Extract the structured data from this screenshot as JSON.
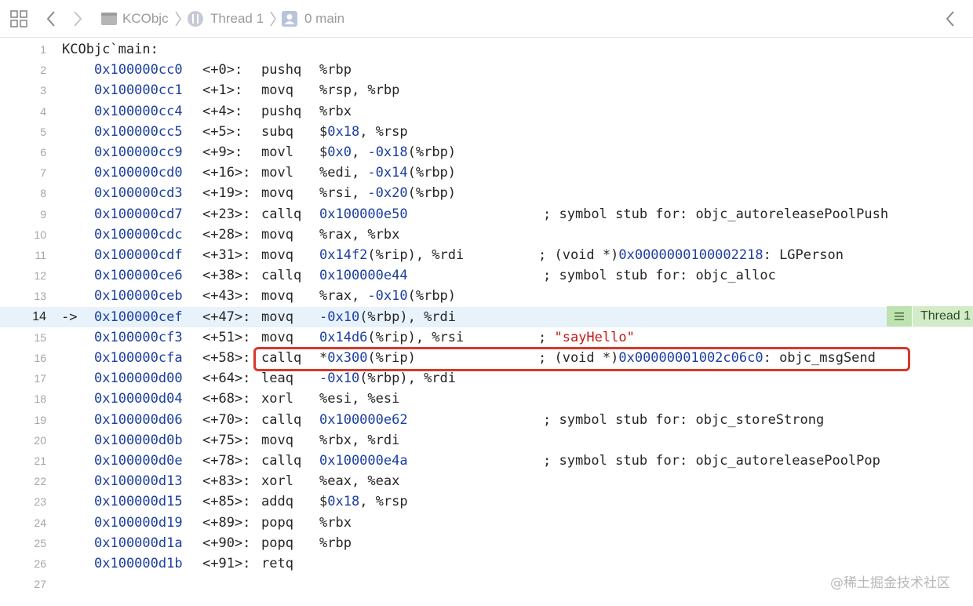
{
  "jumpbar": {
    "project": "KCObjc",
    "thread": "Thread 1",
    "frame": "0 main"
  },
  "editor": {
    "lines": [
      {
        "n": "1",
        "header": "KCObjc`main:"
      },
      {
        "n": "2",
        "addr": "0x100000cc0",
        "off": "<+0>:",
        "mn": "pushq",
        "ops": [
          [
            "%rbp",
            "t"
          ]
        ]
      },
      {
        "n": "3",
        "addr": "0x100000cc1",
        "off": "<+1>:",
        "mn": "movq",
        "ops": [
          [
            "%rsp, %rbp",
            "t"
          ]
        ]
      },
      {
        "n": "4",
        "addr": "0x100000cc4",
        "off": "<+4>:",
        "mn": "pushq",
        "ops": [
          [
            "%rbx",
            "t"
          ]
        ]
      },
      {
        "n": "5",
        "addr": "0x100000cc5",
        "off": "<+5>:",
        "mn": "subq",
        "ops": [
          [
            "$",
            "t"
          ],
          [
            "0x18",
            "n"
          ],
          [
            ", %rsp",
            "t"
          ]
        ]
      },
      {
        "n": "6",
        "addr": "0x100000cc9",
        "off": "<+9>:",
        "mn": "movl",
        "ops": [
          [
            "$",
            "t"
          ],
          [
            "0x0",
            "n"
          ],
          [
            ", ",
            "t"
          ],
          [
            "-0x18",
            "n"
          ],
          [
            "(%rbp)",
            "t"
          ]
        ]
      },
      {
        "n": "7",
        "addr": "0x100000cd0",
        "off": "<+16>:",
        "mn": "movl",
        "ops": [
          [
            "%edi, ",
            "t"
          ],
          [
            "-0x14",
            "n"
          ],
          [
            "(%rbp)",
            "t"
          ]
        ]
      },
      {
        "n": "8",
        "addr": "0x100000cd3",
        "off": "<+19>:",
        "mn": "movq",
        "ops": [
          [
            "%rsi, ",
            "t"
          ],
          [
            "-0x20",
            "n"
          ],
          [
            "(%rbp)",
            "t"
          ]
        ]
      },
      {
        "n": "9",
        "addr": "0x100000cd7",
        "off": "<+23>:",
        "mn": "callq",
        "ops": [
          [
            "0x100000e50",
            "n"
          ]
        ],
        "cmx": 692,
        "cm": [
          [
            "; symbol stub for: objc_autoreleasePoolPush",
            "t"
          ]
        ]
      },
      {
        "n": "10",
        "addr": "0x100000cdc",
        "off": "<+28>:",
        "mn": "movq",
        "ops": [
          [
            "%rax, %rbx",
            "t"
          ]
        ]
      },
      {
        "n": "11",
        "addr": "0x100000cdf",
        "off": "<+31>:",
        "mn": "movq",
        "ops": [
          [
            "0x14f2",
            "n"
          ],
          [
            "(%rip), %rdi",
            "t"
          ]
        ],
        "cmx": 686,
        "cm": [
          [
            "; (void *)",
            "t"
          ],
          [
            "0x0000000100002218",
            "n"
          ],
          [
            ": LGPerson",
            "t"
          ]
        ]
      },
      {
        "n": "12",
        "addr": "0x100000ce6",
        "off": "<+38>:",
        "mn": "callq",
        "ops": [
          [
            "0x100000e44",
            "n"
          ]
        ],
        "cmx": 692,
        "cm": [
          [
            "; symbol stub for: objc_alloc",
            "t"
          ]
        ]
      },
      {
        "n": "13",
        "addr": "0x100000ceb",
        "off": "<+43>:",
        "mn": "movq",
        "ops": [
          [
            "%rax, ",
            "t"
          ],
          [
            "-0x10",
            "n"
          ],
          [
            "(%rbp)",
            "t"
          ]
        ]
      },
      {
        "n": "14",
        "current": true,
        "arrow": "->",
        "addr": "0x100000cef",
        "off": "<+47>:",
        "mn": "movq",
        "ops": [
          [
            "-0x10",
            "n"
          ],
          [
            "(%rbp), %rdi",
            "t"
          ]
        ]
      },
      {
        "n": "15",
        "addr": "0x100000cf3",
        "off": "<+51>:",
        "mn": "movq",
        "ops": [
          [
            "0x14d6",
            "n"
          ],
          [
            "(%rip), %rsi",
            "t"
          ]
        ],
        "cmx": 686,
        "cm": [
          [
            "; ",
            "t"
          ],
          [
            "\"sayHello\"",
            "s"
          ]
        ]
      },
      {
        "n": "16",
        "addr": "0x100000cfa",
        "off": "<+58>:",
        "mn": "callq",
        "ops": [
          [
            "*",
            "t"
          ],
          [
            "0x300",
            "n"
          ],
          [
            "(%rip)",
            "t"
          ]
        ],
        "cmx": 686,
        "cm": [
          [
            "; (void *)",
            "t"
          ],
          [
            "0x00000001002c06c0",
            "n"
          ],
          [
            ": objc_msgSend",
            "t"
          ]
        ]
      },
      {
        "n": "17",
        "addr": "0x100000d00",
        "off": "<+64>:",
        "mn": "leaq",
        "ops": [
          [
            "-0x10",
            "n"
          ],
          [
            "(%rbp), %rdi",
            "t"
          ]
        ]
      },
      {
        "n": "18",
        "addr": "0x100000d04",
        "off": "<+68>:",
        "mn": "xorl",
        "ops": [
          [
            "%esi, %esi",
            "t"
          ]
        ]
      },
      {
        "n": "19",
        "addr": "0x100000d06",
        "off": "<+70>:",
        "mn": "callq",
        "ops": [
          [
            "0x100000e62",
            "n"
          ]
        ],
        "cmx": 692,
        "cm": [
          [
            "; symbol stub for: objc_storeStrong",
            "t"
          ]
        ]
      },
      {
        "n": "20",
        "addr": "0x100000d0b",
        "off": "<+75>:",
        "mn": "movq",
        "ops": [
          [
            "%rbx, %rdi",
            "t"
          ]
        ]
      },
      {
        "n": "21",
        "addr": "0x100000d0e",
        "off": "<+78>:",
        "mn": "callq",
        "ops": [
          [
            "0x100000e4a",
            "n"
          ]
        ],
        "cmx": 692,
        "cm": [
          [
            "; symbol stub for: objc_autoreleasePoolPop",
            "t"
          ]
        ]
      },
      {
        "n": "22",
        "addr": "0x100000d13",
        "off": "<+83>:",
        "mn": "xorl",
        "ops": [
          [
            "%eax, %eax",
            "t"
          ]
        ]
      },
      {
        "n": "23",
        "addr": "0x100000d15",
        "off": "<+85>:",
        "mn": "addq",
        "ops": [
          [
            "$",
            "t"
          ],
          [
            "0x18",
            "n"
          ],
          [
            ", %rsp",
            "t"
          ]
        ]
      },
      {
        "n": "24",
        "addr": "0x100000d19",
        "off": "<+89>:",
        "mn": "popq",
        "ops": [
          [
            "%rbx",
            "t"
          ]
        ]
      },
      {
        "n": "25",
        "addr": "0x100000d1a",
        "off": "<+90>:",
        "mn": "popq",
        "ops": [
          [
            "%rbp",
            "t"
          ]
        ]
      },
      {
        "n": "26",
        "addr": "0x100000d1b",
        "off": "<+91>:",
        "mn": "retq"
      },
      {
        "n": "27"
      }
    ]
  },
  "badge": {
    "text": "Thread 1"
  },
  "watermark": "@稀土掘金技术社区"
}
